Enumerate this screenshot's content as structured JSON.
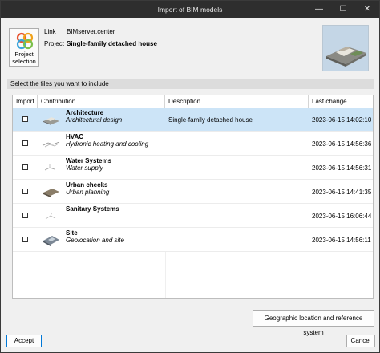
{
  "window": {
    "title": "Import of BIM models"
  },
  "titlebar_buttons": {
    "minimize": "—",
    "maximize": "☐",
    "close": "✕"
  },
  "project_button": {
    "line1": "Project",
    "line2": "selection"
  },
  "info": {
    "link_label": "Link",
    "link_value": "BIMserver.center",
    "project_label": "Project",
    "project_value": "Single-family detached house"
  },
  "section_header": "Select the files you want to include",
  "columns": [
    "Import",
    "Contribution",
    "Description",
    "Last change"
  ],
  "rows": [
    {
      "name": "Architecture",
      "subtitle": "Architectural design",
      "description": "Single-family detached house",
      "last_change": "2023-06-15 14:02:10",
      "selected": true,
      "icon": "building-model-icon"
    },
    {
      "name": "HVAC",
      "subtitle": "Hydronic heating and cooling",
      "description": "",
      "last_change": "2023-06-15 14:56:36",
      "selected": false,
      "icon": "hvac-model-icon"
    },
    {
      "name": "Water Systems",
      "subtitle": "Water supply",
      "description": "",
      "last_change": "2023-06-15 14:56:31",
      "selected": false,
      "icon": "water-model-icon"
    },
    {
      "name": "Urban checks",
      "subtitle": "Urban planning",
      "description": "",
      "last_change": "2023-06-15 14:41:35",
      "selected": false,
      "icon": "urban-model-icon"
    },
    {
      "name": "Sanitary Systems",
      "subtitle": "",
      "description": "",
      "last_change": "2023-06-15 16:06:44",
      "selected": false,
      "icon": "sanitary-model-icon"
    },
    {
      "name": "Site",
      "subtitle": "Geolocation and site",
      "description": "",
      "last_change": "2023-06-15 14:56:11",
      "selected": false,
      "icon": "site-model-icon"
    }
  ],
  "buttons": {
    "geographic": "Geographic location and reference system",
    "accept": "Accept",
    "cancel": "Cancel"
  },
  "colors": {
    "selection": "#cce4f7",
    "titlebar": "#2e2e2e",
    "accent": "#0078d7"
  }
}
